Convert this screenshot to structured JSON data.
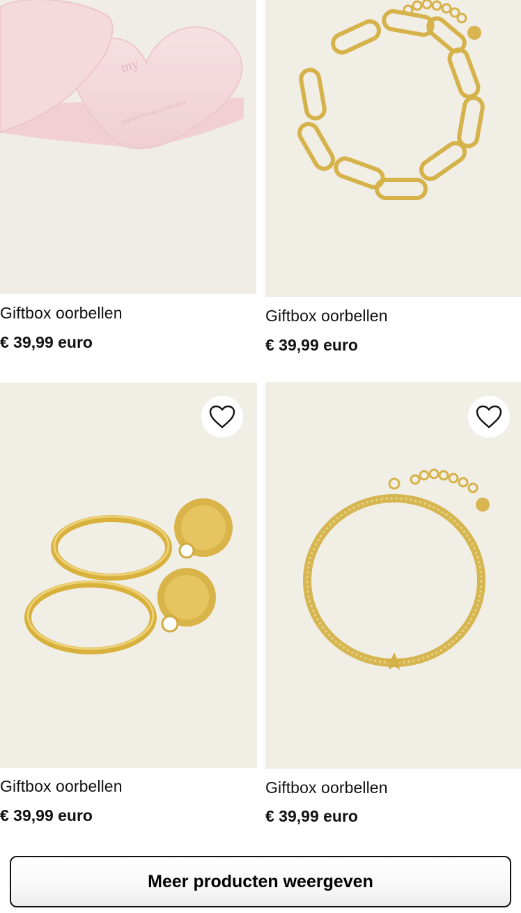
{
  "products": [
    {
      "title": "Giftbox oorbellen",
      "price": "€ 39,99 euro",
      "image_icon": "heart-giftbox-image",
      "box_lid_text": "my",
      "box_text": "3 GIFTS TO SAY I LOVE YOU!",
      "has_wishlist": false
    },
    {
      "title": "Giftbox oorbellen",
      "price": "€ 39,99 euro",
      "image_icon": "chain-bracelet-image",
      "has_wishlist": false
    },
    {
      "title": "Giftbox oorbellen",
      "price": "€ 39,99 euro",
      "image_icon": "hoop-earrings-image",
      "has_wishlist": true
    },
    {
      "title": "Giftbox oorbellen",
      "price": "€ 39,99 euro",
      "image_icon": "snake-chain-bracelet-image",
      "has_wishlist": true
    }
  ],
  "wishlist_icon": "heart-outline-icon",
  "load_more_label": "Meer producten weergeven",
  "colors": {
    "background": "#ffffff",
    "image_bg": "#f1eee6",
    "gold": "#d9b64e",
    "pink_box": "#f3d8dc",
    "text": "#111111"
  }
}
